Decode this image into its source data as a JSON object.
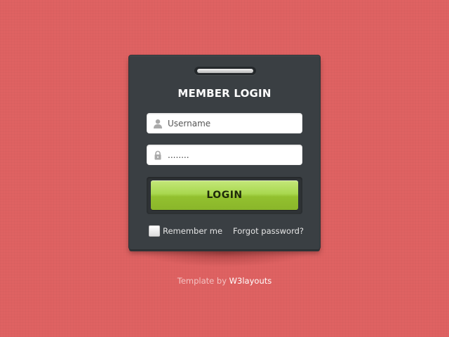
{
  "login": {
    "title": "MEMBER LOGIN",
    "username_placeholder": "Username",
    "password_value": "........",
    "submit_label": "LOGIN",
    "remember_label": "Remember me",
    "forgot_label": "Forgot password?"
  },
  "footer": {
    "prefix": "Template by",
    "link_label": "W3layouts"
  },
  "icons": {
    "username": "user-icon",
    "password": "lock-icon"
  },
  "colors": {
    "background": "#df6262",
    "card": "#3a3f43",
    "button": "#a9d84f"
  }
}
